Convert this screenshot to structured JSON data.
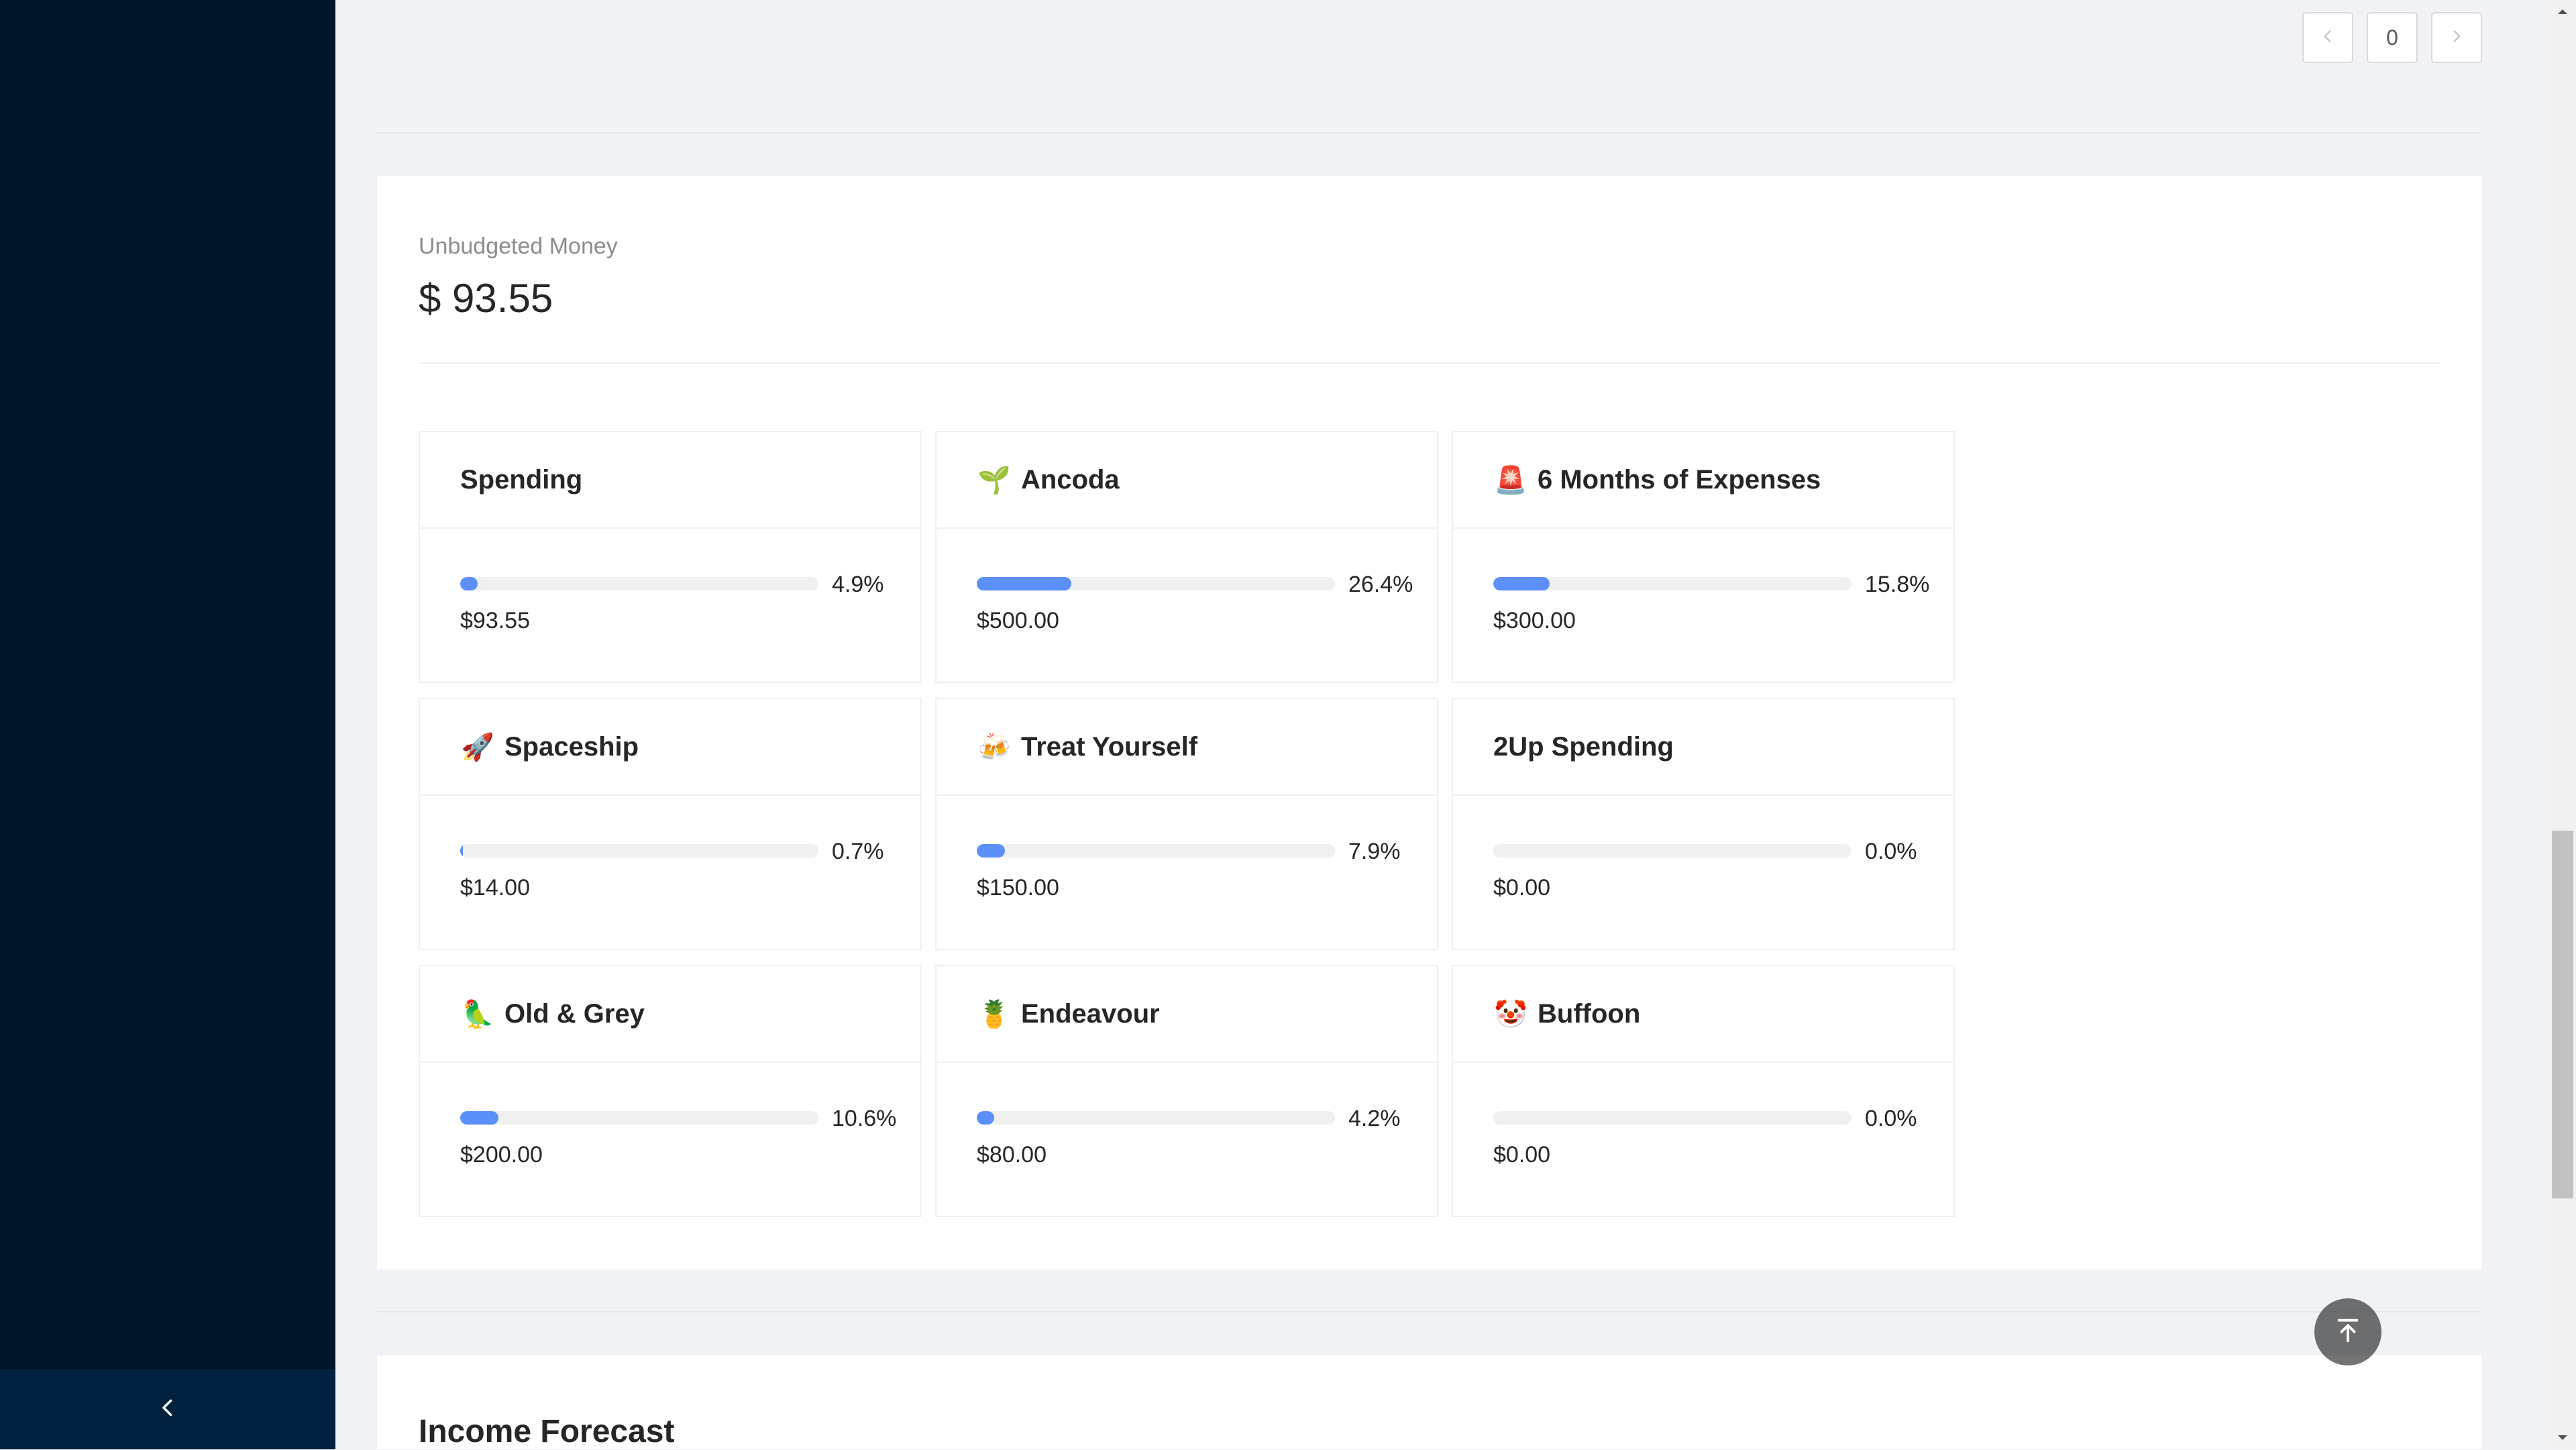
{
  "pager": {
    "prev_icon": "chevron-left-icon",
    "page": "0",
    "next_icon": "chevron-right-icon"
  },
  "unbudgeted": {
    "label": "Unbudgeted Money",
    "value": "$ 93.55"
  },
  "goals": [
    {
      "name": "Spending",
      "emoji": "",
      "percent_label": "4.9%",
      "percent": 4.9,
      "amount": "$93.55"
    },
    {
      "name": "Ancoda",
      "emoji": "🌱",
      "percent_label": "26.4%",
      "percent": 26.4,
      "amount": "$500.00"
    },
    {
      "name": "6 Months of Expenses",
      "emoji": "🚨",
      "percent_label": "15.8%",
      "percent": 15.8,
      "amount": "$300.00"
    },
    {
      "name": "Spaceship",
      "emoji": "🚀",
      "percent_label": "0.7%",
      "percent": 0.7,
      "amount": "$14.00"
    },
    {
      "name": "Treat Yourself",
      "emoji": "🍻",
      "percent_label": "7.9%",
      "percent": 7.9,
      "amount": "$150.00"
    },
    {
      "name": "2Up Spending",
      "emoji": "",
      "percent_label": "0.0%",
      "percent": 0.0,
      "amount": "$0.00"
    },
    {
      "name": "Old & Grey",
      "emoji": "🦜",
      "percent_label": "10.6%",
      "percent": 10.6,
      "amount": "$200.00"
    },
    {
      "name": "Endeavour",
      "emoji": "🍍",
      "percent_label": "4.2%",
      "percent": 4.2,
      "amount": "$80.00"
    },
    {
      "name": "Buffoon",
      "emoji": "🤡",
      "percent_label": "0.0%",
      "percent": 0.0,
      "amount": "$0.00"
    }
  ],
  "forecast": {
    "title": "Income Forecast"
  },
  "colors": {
    "sidebar": "#001529",
    "progress": "#5b8ff9",
    "track": "#f0f0f0"
  },
  "icons": {
    "collapse": "chevron-left-icon",
    "back_to_top": "arrow-up-to-line-icon"
  }
}
